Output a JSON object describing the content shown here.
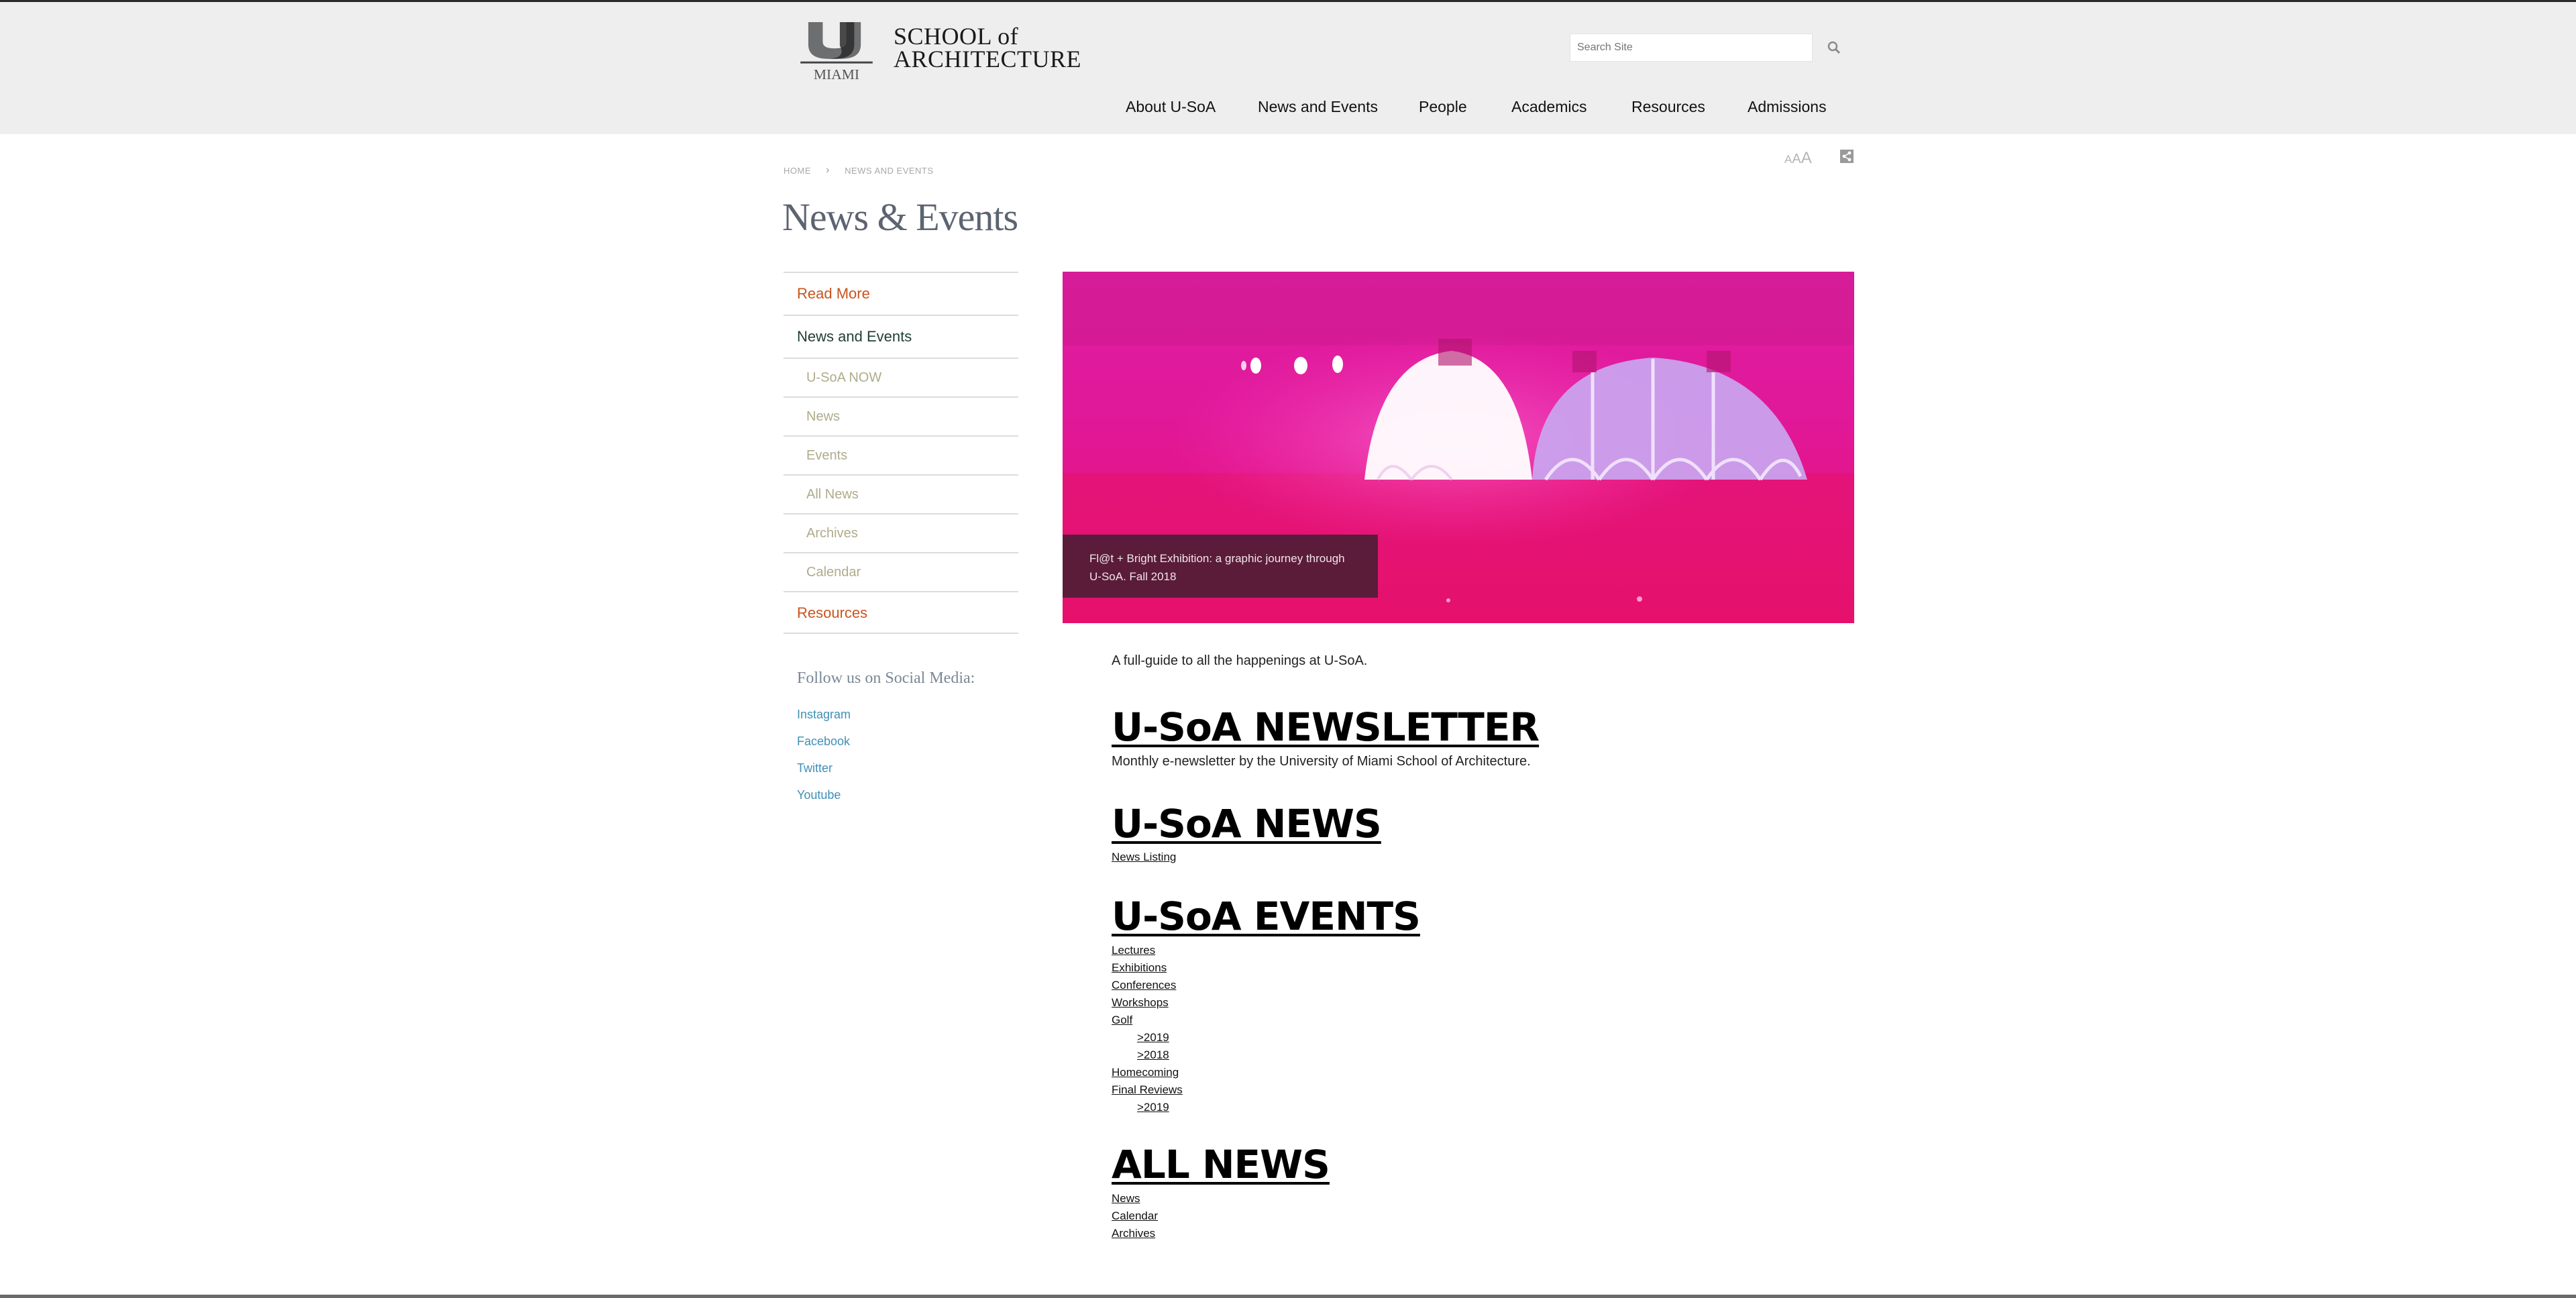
{
  "header": {
    "logo_word": "MIAMI",
    "school_line1": "SCHOOL of",
    "school_line2": "ARCHITECTURE",
    "search_placeholder": "Search Site",
    "nav": [
      "About U-SoA",
      "News and Events",
      "People",
      "Academics",
      "Resources",
      "Admissions"
    ]
  },
  "utility": {
    "text_size_a1": "A",
    "text_size_a2": "A",
    "text_size_a3": "A"
  },
  "breadcrumb": {
    "home": "HOME",
    "current": "NEWS AND EVENTS"
  },
  "page_title": "News & Events",
  "sidebar": {
    "items": [
      {
        "label": "Read More"
      },
      {
        "label": "News and Events"
      },
      {
        "label": "U-SoA NOW"
      },
      {
        "label": "News"
      },
      {
        "label": "Events"
      },
      {
        "label": "All News"
      },
      {
        "label": "Archives"
      },
      {
        "label": "Calendar"
      },
      {
        "label": "Resources"
      }
    ],
    "social_title": "Follow us on Social Media:",
    "social_links": [
      "Instagram",
      "Facebook",
      "Twitter",
      "Youtube"
    ]
  },
  "hero": {
    "caption": "Fl@t + Bright Exhibition: a graphic journey through U-SoA. Fall 2018",
    "colors": {
      "magenta": "#e01ea0",
      "pink": "#e8106e",
      "caption_bg": "#3c1e2d"
    }
  },
  "content": {
    "intro": "A full-guide to all the happenings at U-SoA.",
    "newsletter": {
      "heading": "U-SoA NEWSLETTER",
      "description": "Monthly e-newsletter by the University of Miami School of Architecture."
    },
    "news": {
      "heading": "U-SoA NEWS",
      "links": [
        "News Listing"
      ]
    },
    "events": {
      "heading": "U-SoA EVENTS",
      "links": [
        "Lectures",
        "Exhibitions",
        "Conferences",
        "Workshops",
        "Golf",
        ">2019",
        ">2018",
        "Homecoming",
        "Final Reviews",
        ">2019"
      ]
    },
    "all_news": {
      "heading": "ALL NEWS",
      "links": [
        "News",
        "Calendar",
        "Archives"
      ]
    }
  },
  "colors": {
    "accent_orange": "#c8541e",
    "link_blue": "#3f8fb7",
    "header_bg": "#eeeeef"
  }
}
